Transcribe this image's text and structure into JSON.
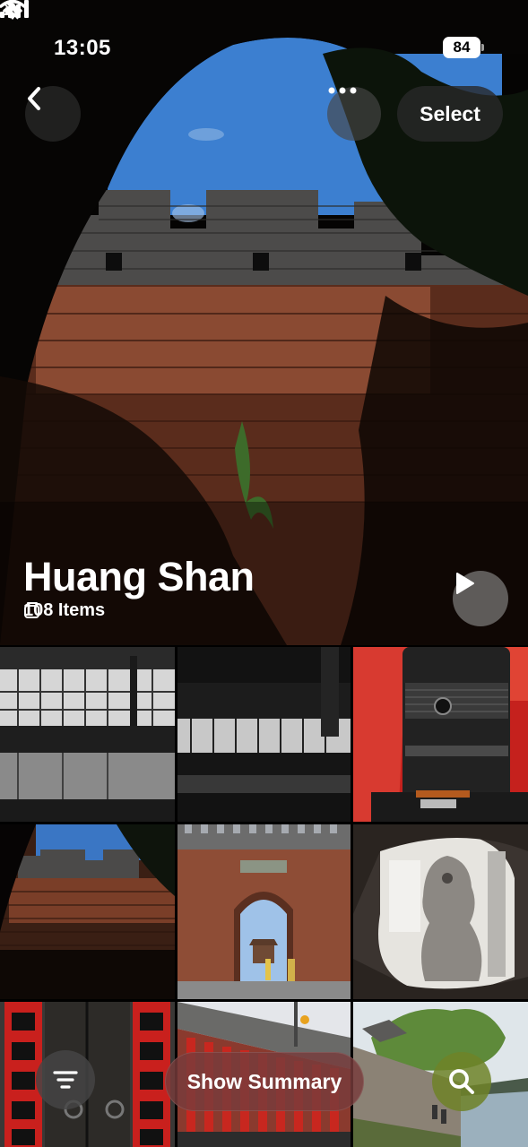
{
  "status_bar": {
    "time": "13:05",
    "battery": "84",
    "icons": [
      "bell-slash-icon",
      "signal-icon",
      "wifi-icon",
      "battery-icon"
    ]
  },
  "nav": {
    "back_icon": "chevron-left-icon",
    "more_icon": "ellipsis-icon",
    "select_label": "Select"
  },
  "album": {
    "title": "Huang Shan",
    "count_label": "108 Items",
    "count_icon": "stack-icon",
    "play_icon": "play-icon"
  },
  "grid": {
    "tiles": [
      "airport-terminal-photo",
      "airport-hall-photo",
      "sony-lens-photo",
      "city-wall-photo",
      "city-gate-photo",
      "stone-lion-photo",
      "red-couplet-door-photo",
      "red-wall-street-photo",
      "riverside-trees-photo"
    ]
  },
  "bottom": {
    "filter_icon": "filter-icon",
    "summary_label": "Show Summary",
    "search_icon": "search-icon"
  },
  "colors": {
    "accent_search": "#6e8228",
    "summary_bg": "#783c3c"
  }
}
